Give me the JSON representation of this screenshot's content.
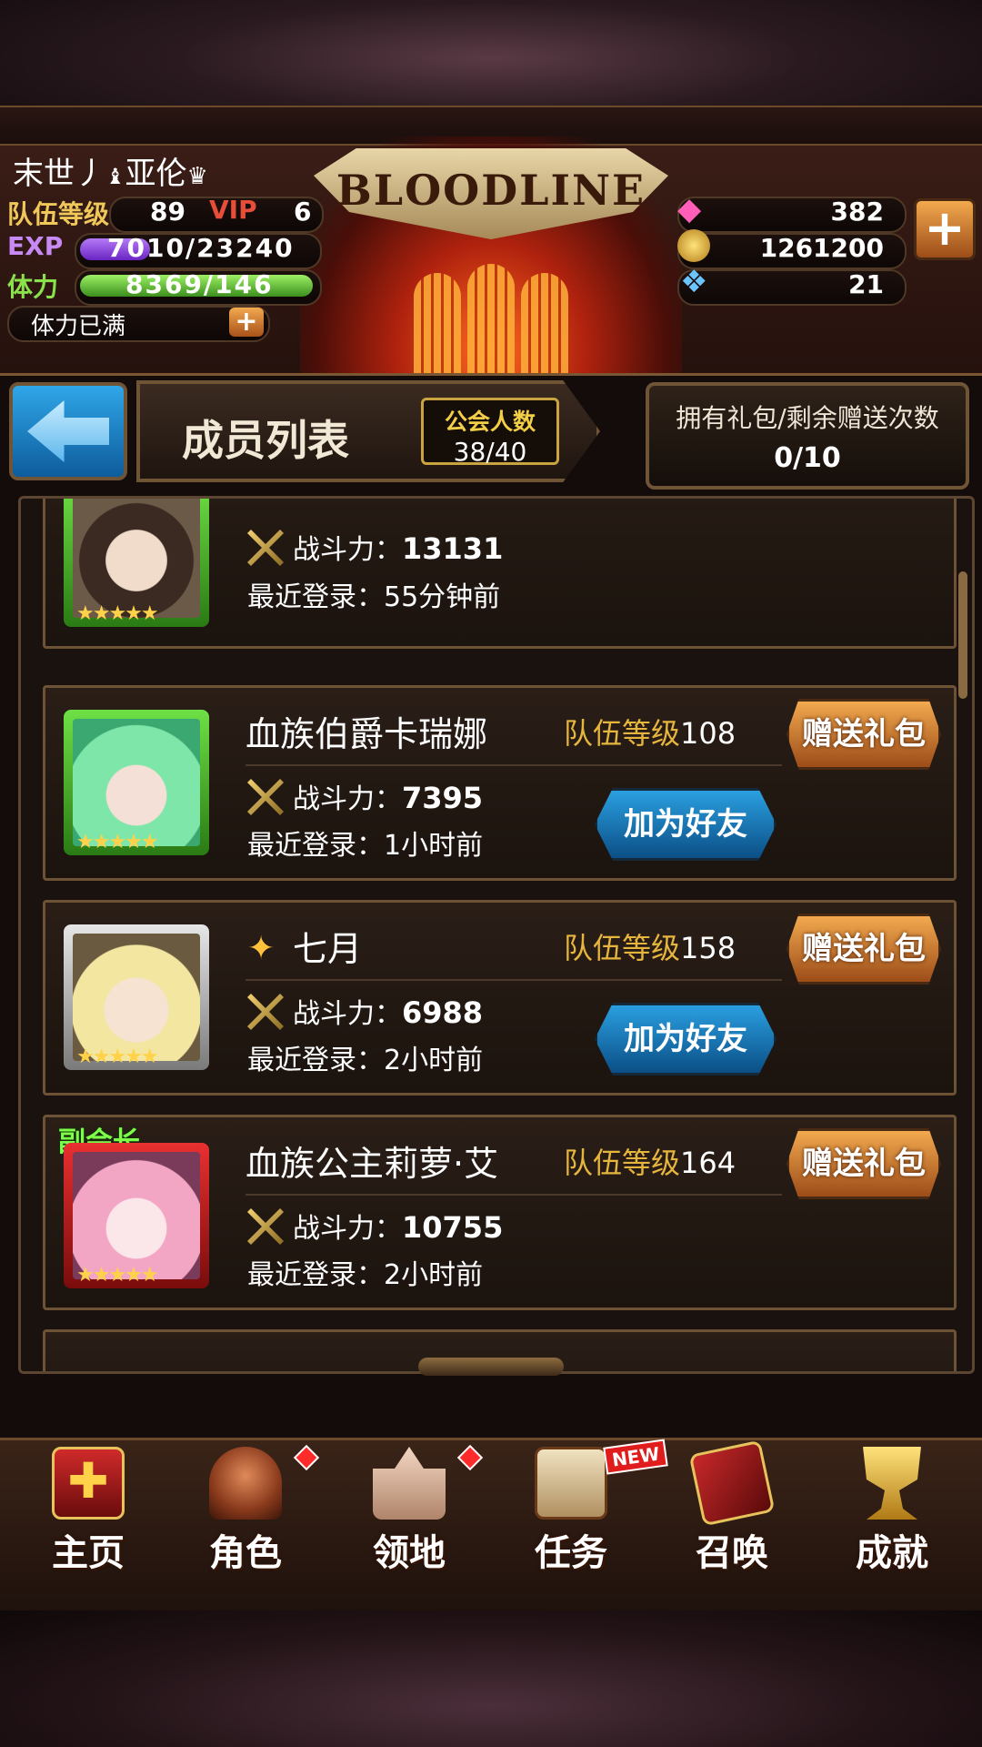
{
  "hud": {
    "player_name": "末世丿",
    "player_name2": "亚伦",
    "team_level_label": "队伍等级",
    "team_level": "89",
    "vip_label": "VIP",
    "vip_level": "6",
    "exp_label": "EXP",
    "exp_value": "7010/23240",
    "exp_fraction": 0.3,
    "stamina_label": "体力",
    "stamina_value": "8369/146",
    "stamina_fraction": 1.0,
    "stamina_status": "体力已满",
    "gems": "382",
    "gold": "1261200",
    "crystal": "21",
    "logo": "BLOODLINE"
  },
  "header": {
    "title": "成员列表",
    "guild_count_label": "公会人数",
    "guild_count": "38/40",
    "gift_label": "拥有礼包/剩余赠送次数",
    "gift_value": "0/10"
  },
  "members": [
    {
      "name": "",
      "level_label": "",
      "level": "",
      "power_label": "战斗力：",
      "power": "13131",
      "login_label": "最近登录：",
      "login": "55分钟前",
      "gift": ""
    },
    {
      "name": "血族伯爵卡瑞娜",
      "level_label": "队伍等级",
      "level": "108",
      "power_label": "战斗力：",
      "power": "7395",
      "login_label": "最近登录：",
      "login": "1小时前",
      "gift": "赠送礼包",
      "friend": "加为好友"
    },
    {
      "name": "七月",
      "level_label": "队伍等级",
      "level": "158",
      "power_label": "战斗力：",
      "power": "6988",
      "login_label": "最近登录：",
      "login": "2小时前",
      "gift": "赠送礼包",
      "friend": "加为好友"
    },
    {
      "name": "血族公主莉萝·艾",
      "role": "副会长",
      "level_label": "队伍等级",
      "level": "164",
      "power_label": "战斗力：",
      "power": "10755",
      "login_label": "最近登录：",
      "login": "2小时前",
      "gift": "赠送礼包"
    }
  ],
  "nav": {
    "home": "主页",
    "character": "角色",
    "territory": "领地",
    "quest": "任务",
    "summon": "召唤",
    "achievement": "成就",
    "new_badge": "NEW"
  },
  "colors": {
    "gold_text": "#e6b53d",
    "gift_button": "#d9852f",
    "friend_button": "#1f84c8",
    "exp_bar": "#8b3fe0",
    "stamina_bar": "#4fb82a"
  }
}
